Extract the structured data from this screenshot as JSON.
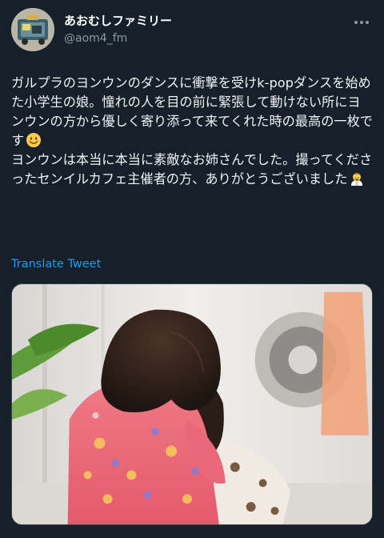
{
  "author": {
    "display_name": "あおむしファミリー",
    "handle": "@aom4_fm"
  },
  "tweet": {
    "paragraph1": "ガルプラのヨンウンのダンスに衝撃を受けk-popダンスを始めた小学生の娘。憧れの人を目の前に緊張して動けない所にヨンウンの方から優しく寄り添って来てくれた時の最高の一枚です",
    "paragraph2": "ヨンウンは本当に本当に素敵なお姉さんでした。撮ってくださったセンイルカフェ主催者の方、ありがとうございました",
    "emoji1": "smiling-face-icon",
    "emoji2": "bowing-person-icon"
  },
  "translate_label": "Translate Tweet",
  "icons": {
    "more": "more-options-icon"
  },
  "colors": {
    "background": "#15202b",
    "link": "#1d9bf0",
    "secondary_text": "#8b98a5",
    "primary_text": "#ffffff"
  }
}
